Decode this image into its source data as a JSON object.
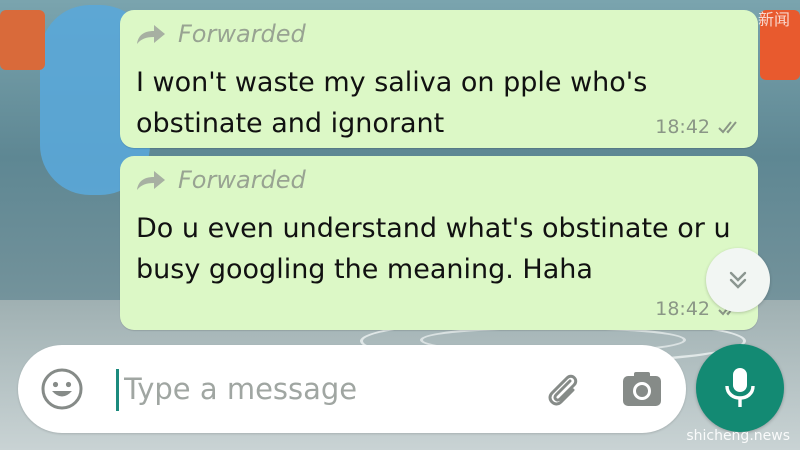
{
  "messages": [
    {
      "forwarded_label": "Forwarded",
      "text": "I won't waste my saliva on pple who's obstinate and ignorant",
      "time": "18:42",
      "status_icon": "double-check-icon"
    },
    {
      "forwarded_label": "Forwarded",
      "text": "Do u even understand what's obstinate or u busy googling the meaning. Haha",
      "time": "18:42",
      "status_icon": "double-check-icon"
    }
  ],
  "composer": {
    "placeholder": "Type a message",
    "value": "",
    "emoji_icon": "emoji-icon",
    "attach_icon": "paperclip-icon",
    "camera_icon": "camera-icon",
    "mic_icon": "microphone-icon"
  },
  "scroll_down_icon": "double-chevron-down-icon",
  "watermarks": {
    "top": "新闻",
    "bottom": "shicheng.news"
  },
  "colors": {
    "outgoing_bubble": "#dcf8c6",
    "accent": "#138a73",
    "meta_text": "#8a9686"
  }
}
